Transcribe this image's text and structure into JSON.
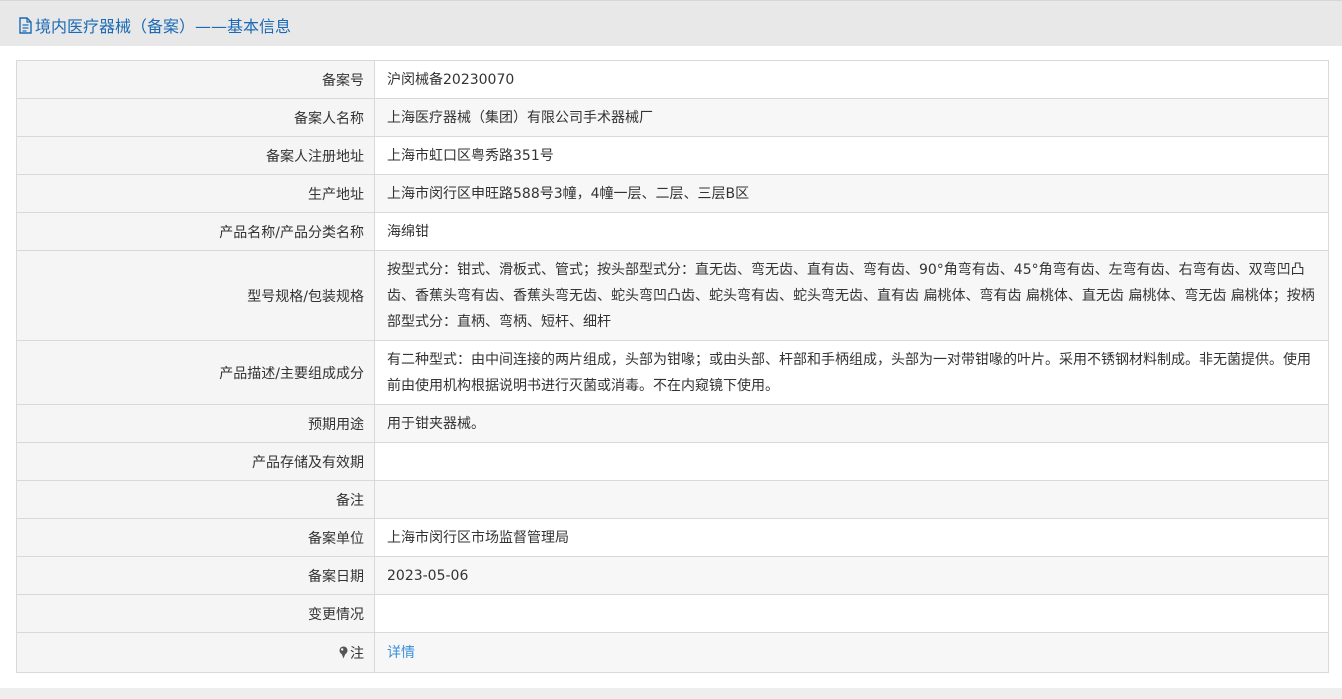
{
  "header": {
    "title": "境内医疗器械（备案）——基本信息",
    "icon": "document-icon"
  },
  "colors": {
    "title": "#1b6ab5",
    "link": "#3a8fd9",
    "label_bg": "#f5f5f5",
    "border": "#d9d9d9"
  },
  "rows": [
    {
      "label": "备案号",
      "value": "沪闵械备20230070"
    },
    {
      "label": "备案人名称",
      "value": "上海医疗器械（集团）有限公司手术器械厂"
    },
    {
      "label": "备案人注册地址",
      "value": "上海市虹口区粤秀路351号"
    },
    {
      "label": "生产地址",
      "value": "上海市闵行区申旺路588号3幢，4幢一层、二层、三层B区"
    },
    {
      "label": "产品名称/产品分类名称",
      "value": "海绵钳"
    },
    {
      "label": "型号规格/包装规格",
      "value": "按型式分：钳式、滑板式、管式；按头部型式分：直无齿、弯无齿、直有齿、弯有齿、90°角弯有齿、45°角弯有齿、左弯有齿、右弯有齿、双弯凹凸齿、香蕉头弯有齿、香蕉头弯无齿、蛇头弯凹凸齿、蛇头弯有齿、蛇头弯无齿、直有齿 扁桃体、弯有齿 扁桃体、直无齿 扁桃体、弯无齿 扁桃体；按柄部型式分：直柄、弯柄、短杆、细杆"
    },
    {
      "label": "产品描述/主要组成成分",
      "value": "有二种型式：由中间连接的两片组成，头部为钳喙；或由头部、杆部和手柄组成，头部为一对带钳喙的叶片。采用不锈钢材料制成。非无菌提供。使用前由使用机构根据说明书进行灭菌或消毒。不在内窥镜下使用。"
    },
    {
      "label": "预期用途",
      "value": "用于钳夹器械。"
    },
    {
      "label": "产品存储及有效期",
      "value": ""
    },
    {
      "label": "备注",
      "value": ""
    },
    {
      "label": "备案单位",
      "value": "上海市闵行区市场监督管理局"
    },
    {
      "label": "备案日期",
      "value": "2023-05-06"
    },
    {
      "label": "变更情况",
      "value": ""
    },
    {
      "label": "注",
      "value": "详情",
      "icon": "pin-icon"
    }
  ]
}
